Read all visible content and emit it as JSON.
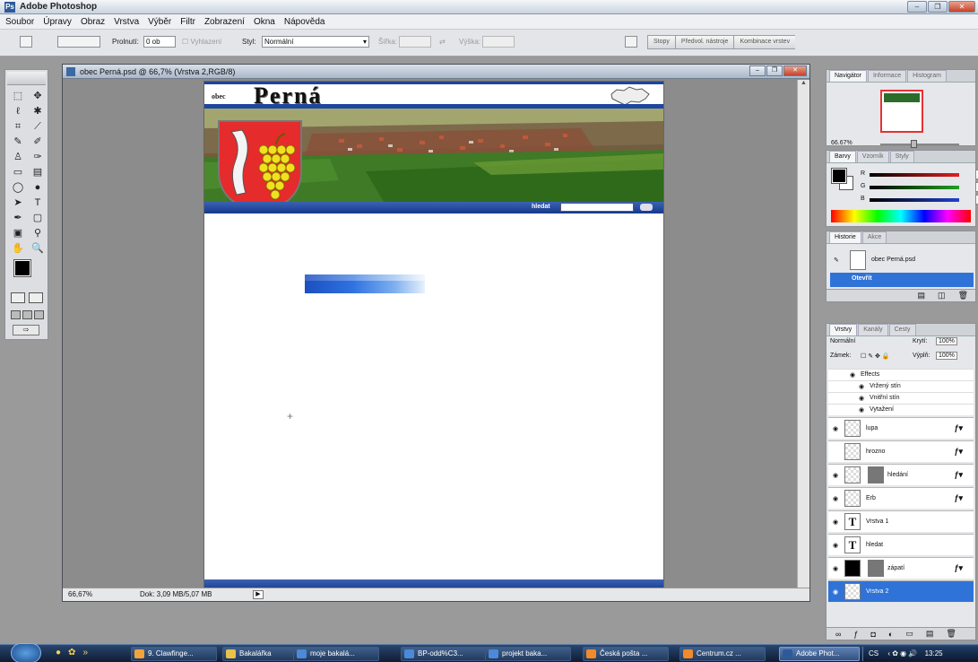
{
  "app": {
    "title": "Adobe Photoshop"
  },
  "menu": [
    "Soubor",
    "Úpravy",
    "Obraz",
    "Vrstva",
    "Výběr",
    "Filtr",
    "Zobrazení",
    "Okna",
    "Nápověda"
  ],
  "options": {
    "prolnuti_label": "Prolnutí:",
    "prolnuti_value": "0 ob",
    "vyhlazeni_label": "Vyhlazení",
    "styl_label": "Styl:",
    "styl_value": "Normální",
    "sirka_label": "Šířka:",
    "vyska_label": "Výška:",
    "wells": [
      "Stopy",
      "Předvol. nástroje",
      "Kombinace vrstev"
    ]
  },
  "document": {
    "title": "obec Perná.psd @ 66,7% (Vrstva 2,RGB/8)",
    "zoom": "66,67%",
    "doc_size": "Dok: 3,09 MB/5,07 MB"
  },
  "site": {
    "obec": "obec",
    "name": "Perná",
    "search_label": "hledat"
  },
  "navigator": {
    "tabs": [
      "Navigátor",
      "Informace",
      "Histogram"
    ],
    "zoom": "66.67%"
  },
  "color_panel": {
    "tabs": [
      "Barvy",
      "Vzorník",
      "Styly"
    ],
    "sliders": [
      {
        "label": "R",
        "value": "0",
        "color": "#e02020"
      },
      {
        "label": "G",
        "value": "0",
        "color": "#20a020"
      },
      {
        "label": "B",
        "value": "0",
        "color": "#2040d0"
      }
    ]
  },
  "history": {
    "tabs": [
      "Historie",
      "Akce"
    ],
    "snapshot": "obec Perná.psd",
    "items": [
      "Otevřít"
    ]
  },
  "layers": {
    "tabs": [
      "Vrstvy",
      "Kanály",
      "Cesty"
    ],
    "blend_mode": "Normální",
    "opacity_label": "Krytí:",
    "opacity": "100%",
    "lock_label": "Zámek:",
    "fill_label": "Výplň:",
    "fill": "100%",
    "effects_label": "Effects",
    "effects": [
      "Vržený stín",
      "Vnitřní stín",
      "Vytažení"
    ],
    "rows": [
      {
        "name": "lupa",
        "thumb": "checker",
        "mask": false,
        "fx": true,
        "eye": true,
        "selected": false
      },
      {
        "name": "hrozno",
        "thumb": "checker",
        "mask": false,
        "fx": true,
        "eye": false,
        "selected": false
      },
      {
        "name": "hledání",
        "thumb": "checker",
        "mask": true,
        "fx": true,
        "eye": true,
        "selected": false
      },
      {
        "name": "Erb",
        "thumb": "checker",
        "mask": false,
        "fx": true,
        "eye": true,
        "selected": false
      },
      {
        "name": "Vrstva 1",
        "thumb": "text",
        "mask": false,
        "fx": false,
        "eye": true,
        "selected": false
      },
      {
        "name": "hledat",
        "thumb": "text",
        "mask": false,
        "fx": false,
        "eye": true,
        "selected": false
      },
      {
        "name": "zápatí",
        "thumb": "black",
        "mask": true,
        "fx": true,
        "eye": true,
        "selected": false
      },
      {
        "name": "Vrstva 2",
        "thumb": "checker",
        "mask": false,
        "fx": false,
        "eye": true,
        "selected": true
      }
    ]
  },
  "taskbar": {
    "items": [
      {
        "label": "9. Clawfinge...",
        "color": "#f2a33a"
      },
      {
        "label": "Bakalářka",
        "color": "#e8c14a"
      },
      {
        "label": "moje bakalá...",
        "color": "#4a8ad8"
      },
      {
        "label": "BP-odd%C3...",
        "color": "#4a8ad8"
      },
      {
        "label": "projekt baka...",
        "color": "#4a8ad8"
      },
      {
        "label": "Česká pošta ...",
        "color": "#f08a2a"
      },
      {
        "label": "Centrum.cz ...",
        "color": "#f08a2a"
      },
      {
        "label": "Adobe Phot...",
        "color": "#2d5b9a"
      }
    ],
    "tray_lang": "CS",
    "clock": "13:25"
  },
  "colors": {
    "brand_blue": "#1c46a0",
    "selection": "#2f73d9"
  },
  "icons": [
    "photoshop-icon",
    "marquee-icon",
    "move-icon",
    "lasso-icon",
    "wand-icon",
    "crop-icon",
    "slice-icon",
    "brush-icon",
    "pencil-icon",
    "stamp-icon",
    "eraser-icon",
    "bucket-icon",
    "dodge-icon",
    "path-select-icon",
    "type-icon",
    "pen-icon",
    "shape-icon",
    "notes-icon",
    "eyedropper-icon",
    "hand-icon",
    "zoom-icon",
    "eye-icon",
    "fx-icon",
    "start-orb-icon"
  ]
}
